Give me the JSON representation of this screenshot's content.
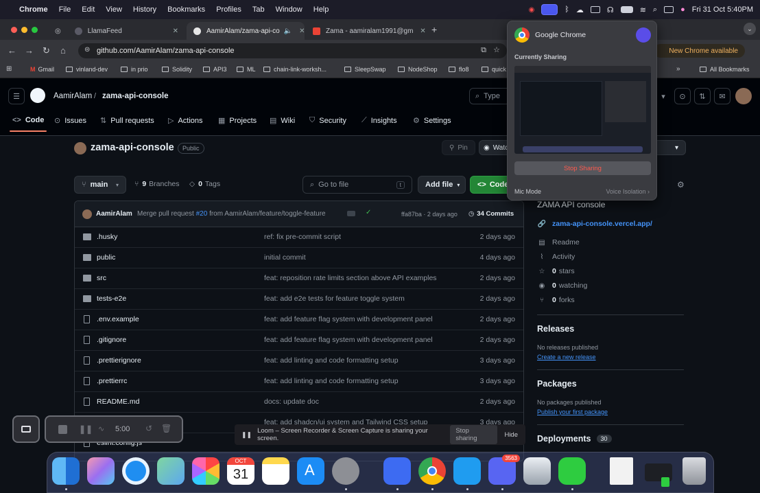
{
  "menubar": {
    "app": "Chrome",
    "items": [
      "File",
      "Edit",
      "View",
      "History",
      "Bookmarks",
      "Profiles",
      "Tab",
      "Window",
      "Help"
    ],
    "clock": "Fri 31 Oct  5:40PM"
  },
  "tabs": [
    {
      "label": "LlamaFeed"
    },
    {
      "label": "AamirAlam/zama-api-co"
    },
    {
      "label": "Zama - aamiralam1991@gm"
    }
  ],
  "address": {
    "url": "github.com/AamirAlam/zama-api-console",
    "update_label": "New Chrome available"
  },
  "bookmarks": [
    "Gmail",
    "vinland-dev",
    "in prio",
    "Solidity",
    "API3",
    "ML",
    "chain-link-worksh...",
    "SleepSwap",
    "NodeShop",
    "flo8",
    "quick"
  ],
  "bookmarks_all": "All Bookmarks",
  "github": {
    "owner": "AamirAlam",
    "repo": "zama-api-console",
    "search_label": "Type",
    "nav": [
      "Code",
      "Issues",
      "Pull requests",
      "Actions",
      "Projects",
      "Wiki",
      "Security",
      "Insights",
      "Settings"
    ],
    "visibility": "Public",
    "pin_label": "Pin",
    "watch_label": "Watch",
    "branch": "main",
    "branches_count": "9",
    "branches_label": "Branches",
    "tags_count": "0",
    "tags_label": "Tags",
    "goto_placeholder": "Go to file",
    "goto_key": "t",
    "addfile_label": "Add file",
    "code_label": "Code"
  },
  "commit": {
    "author": "AamirAlam",
    "message_pre": "Merge pull request",
    "pr": "#20",
    "message_post": "from AamirAlam/feature/toggle-feature",
    "sha_time": "ffa87ba · 2 days ago",
    "count_label": "34 Commits"
  },
  "files": [
    {
      "type": "folder",
      "name": ".husky",
      "msg": "ref: fix pre-commit script",
      "date": "2 days ago"
    },
    {
      "type": "folder",
      "name": "public",
      "msg": "initial commit",
      "date": "4 days ago"
    },
    {
      "type": "folder",
      "name": "src",
      "msg": "feat: reposition rate limits section above API examples",
      "date": "2 days ago"
    },
    {
      "type": "folder",
      "name": "tests-e2e",
      "msg": "feat: add e2e tests for feature toggle system",
      "date": "2 days ago"
    },
    {
      "type": "file",
      "name": ".env.example",
      "msg": "feat: add feature flag system with development panel",
      "date": "2 days ago"
    },
    {
      "type": "file",
      "name": ".gitignore",
      "msg": "feat: add feature flag system with development panel",
      "date": "2 days ago"
    },
    {
      "type": "file",
      "name": ".prettierignore",
      "msg": "feat: add linting and code formatting setup",
      "date": "3 days ago"
    },
    {
      "type": "file",
      "name": ".prettierrc",
      "msg": "feat: add linting and code formatting setup",
      "date": "3 days ago"
    },
    {
      "type": "file",
      "name": "README.md",
      "msg": "docs: update doc",
      "date": "2 days ago"
    },
    {
      "type": "file",
      "name": "",
      "msg": "feat: add shadcn/ui system and Tailwind CSS setup",
      "date": "3 days ago"
    },
    {
      "type": "file",
      "name": "eslint.config.js",
      "msg": "",
      "date": ""
    }
  ],
  "about": {
    "description": "ZAMA API console",
    "link": "zama-api-console.vercel.app/",
    "readme": "Readme",
    "activity": "Activity",
    "stars": "0",
    "stars_label": "stars",
    "watching": "0",
    "watching_label": "watching",
    "forks": "0",
    "forks_label": "forks"
  },
  "releases": {
    "title": "Releases",
    "none": "No releases published",
    "link": "Create a new release"
  },
  "packages": {
    "title": "Packages",
    "none": "No packages published",
    "link": "Publish your first package"
  },
  "deployments": {
    "title": "Deployments",
    "count": "30"
  },
  "popover": {
    "title": "Google Chrome",
    "section": "Currently Sharing",
    "stop": "Stop Sharing",
    "mic_label": "Mic Mode",
    "mic_value": "Voice Isolation"
  },
  "loom": {
    "timer": "5:00",
    "share_text": "Loom – Screen Recorder & Screen Capture is sharing your screen.",
    "stop": "Stop sharing",
    "hide": "Hide"
  },
  "dock": {
    "calendar_month": "OCT",
    "calendar_day": "31",
    "discord_badge": "3563"
  }
}
